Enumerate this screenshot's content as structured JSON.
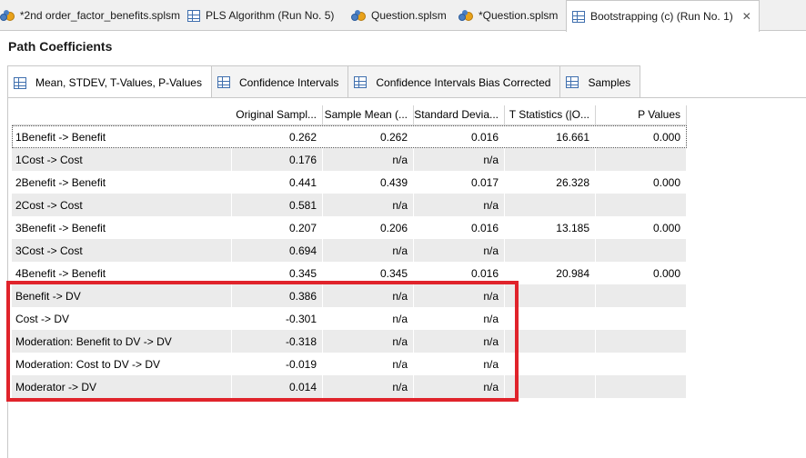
{
  "editor_tabs": [
    {
      "label": "*2nd order_factor_benefits.splsm",
      "icon": "model-icon"
    },
    {
      "label": "PLS Algorithm (Run No. 5)",
      "icon": "table-icon"
    },
    {
      "label": "Question.splsm",
      "icon": "model-icon"
    },
    {
      "label": "*Question.splsm",
      "icon": "model-icon"
    },
    {
      "label": "Bootstrapping (c) (Run No. 1)",
      "icon": "table-icon",
      "close": "✕"
    }
  ],
  "page_title": "Path Coefficients",
  "sub_tabs": [
    "Mean, STDEV, T-Values, P-Values",
    "Confidence Intervals",
    "Confidence Intervals Bias Corrected",
    "Samples"
  ],
  "table": {
    "headers": [
      "",
      "Original Sampl...",
      "Sample Mean (...",
      "Standard Devia...",
      "T Statistics (|O...",
      "P Values"
    ],
    "rows": [
      [
        "1Benefit -> Benefit",
        "0.262",
        "0.262",
        "0.016",
        "16.661",
        "0.000"
      ],
      [
        "1Cost -> Cost",
        "0.176",
        "n/a",
        "n/a",
        "",
        ""
      ],
      [
        "2Benefit -> Benefit",
        "0.441",
        "0.439",
        "0.017",
        "26.328",
        "0.000"
      ],
      [
        "2Cost -> Cost",
        "0.581",
        "n/a",
        "n/a",
        "",
        ""
      ],
      [
        "3Benefit -> Benefit",
        "0.207",
        "0.206",
        "0.016",
        "13.185",
        "0.000"
      ],
      [
        "3Cost -> Cost",
        "0.694",
        "n/a",
        "n/a",
        "",
        ""
      ],
      [
        "4Benefit -> Benefit",
        "0.345",
        "0.345",
        "0.016",
        "20.984",
        "0.000"
      ],
      [
        "Benefit -> DV",
        "0.386",
        "n/a",
        "n/a",
        "",
        ""
      ],
      [
        "Cost -> DV",
        "-0.301",
        "n/a",
        "n/a",
        "",
        ""
      ],
      [
        "Moderation: Benefit to DV -> DV",
        "-0.318",
        "n/a",
        "n/a",
        "",
        ""
      ],
      [
        "Moderation: Cost to DV -> DV",
        "-0.019",
        "n/a",
        "n/a",
        "",
        ""
      ],
      [
        "Moderator -> DV",
        "0.014",
        "n/a",
        "n/a",
        "",
        ""
      ]
    ]
  },
  "colors": {
    "highlight": "#e0232b",
    "alt_row": "#ebebeb"
  }
}
